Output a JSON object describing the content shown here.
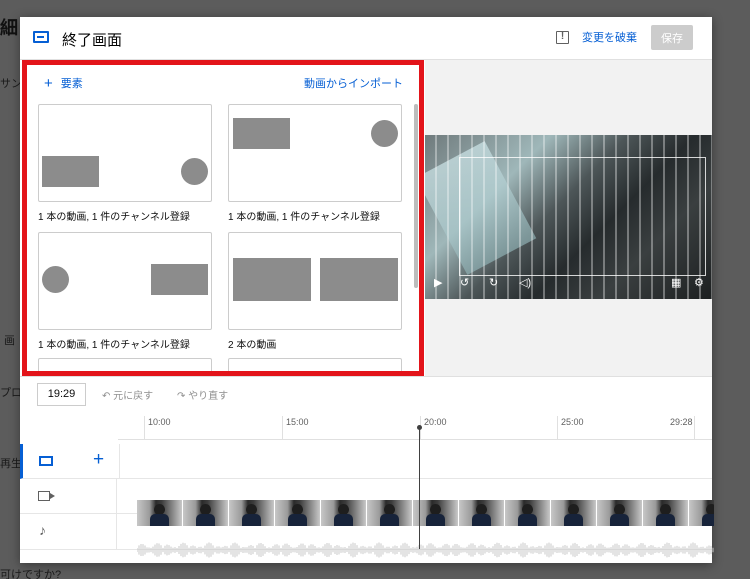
{
  "background": {
    "title_fragment": "細",
    "fragment_1": "サン",
    "fragment_2": "画",
    "fragment_3": "プロー",
    "fragment_4": "再生",
    "fragment_5": "可けですか?"
  },
  "header": {
    "title": "終了画面",
    "discard_label": "変更を破棄",
    "save_label": "保存"
  },
  "panel": {
    "add_element_label": "要素",
    "import_label": "動画からインポート",
    "templates": [
      {
        "label": "1 本の動画, 1 件のチャンネル登録"
      },
      {
        "label": "1 本の動画, 1 件のチャンネル登録"
      },
      {
        "label": "1 本の動画, 1 件のチャンネル登録"
      },
      {
        "label": "2 本の動画"
      }
    ]
  },
  "timeline": {
    "current_time": "19:29",
    "undo_label": "元に戻す",
    "redo_label": "やり直す",
    "ticks": [
      "10:00",
      "15:00",
      "20:00",
      "25:00",
      "29:28"
    ]
  },
  "colors": {
    "accent": "#065fd4",
    "highlight_border": "#e3141a",
    "save_disabled": "#cccccc"
  },
  "icons": {
    "endscreen": "endscreen-icon",
    "feedback": "feedback-icon",
    "add": "plus-icon",
    "video_track": "video-camera-icon",
    "audio_track": "music-note-icon",
    "play": "play-icon",
    "rewind": "rewind-10-icon",
    "forward": "forward-10-icon",
    "volume": "volume-icon",
    "grid": "grid-icon",
    "settings": "settings-gear-icon"
  }
}
